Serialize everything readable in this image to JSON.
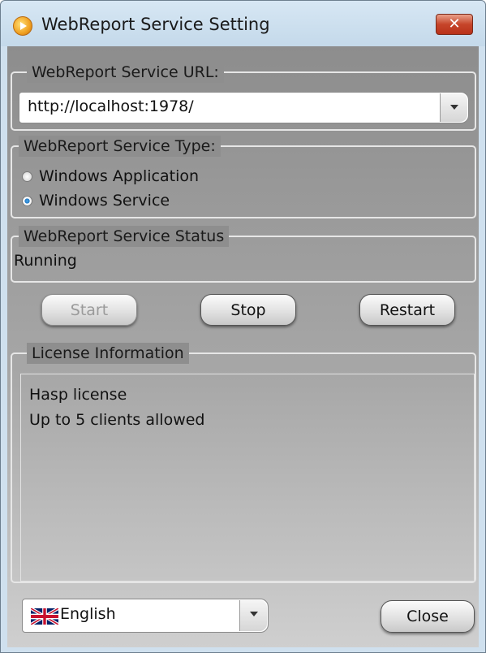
{
  "window": {
    "title": "WebReport Service Setting",
    "close_glyph": "✕"
  },
  "url_group": {
    "legend": "WebReport Service URL:",
    "value": "http://localhost:1978/"
  },
  "type_group": {
    "legend": "WebReport Service Type:",
    "options": [
      {
        "label": "Windows Application",
        "checked": false
      },
      {
        "label": "Windows Service",
        "checked": true
      }
    ]
  },
  "status_group": {
    "legend": "WebReport Service Status",
    "value": "Running"
  },
  "buttons": {
    "start": "Start",
    "stop": "Stop",
    "restart": "Restart",
    "start_enabled": false
  },
  "license_group": {
    "legend": "License Information",
    "lines": [
      "Hasp license",
      "Up to 5 clients allowed"
    ]
  },
  "footer": {
    "language": "English",
    "language_icon": "uk-flag-icon",
    "close_label": "Close"
  },
  "colors": {
    "title_bar": "#cfe0ee",
    "close_button": "#c6452a",
    "panel": "#a7a7a7",
    "radio_selected": "#2176c4"
  }
}
